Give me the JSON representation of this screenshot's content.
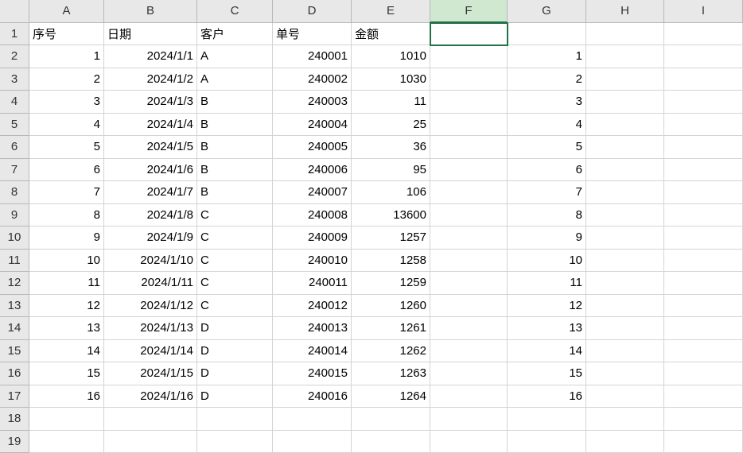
{
  "columns": [
    "A",
    "B",
    "C",
    "D",
    "E",
    "F",
    "G",
    "H",
    "I"
  ],
  "rowCount": 19,
  "selectedCell": "F1",
  "headers": {
    "A": "序号",
    "B": "日期",
    "C": "客户",
    "D": "单号",
    "E": "金额"
  },
  "chart_data": {
    "type": "table",
    "columns": [
      "序号",
      "日期",
      "客户",
      "单号",
      "金额",
      "",
      "G"
    ],
    "rows": [
      [
        1,
        "2024/1/1",
        "A",
        240001,
        1010,
        "",
        1
      ],
      [
        2,
        "2024/1/2",
        "A",
        240002,
        1030,
        "",
        2
      ],
      [
        3,
        "2024/1/3",
        "B",
        240003,
        11,
        "",
        3
      ],
      [
        4,
        "2024/1/4",
        "B",
        240004,
        25,
        "",
        4
      ],
      [
        5,
        "2024/1/5",
        "B",
        240005,
        36,
        "",
        5
      ],
      [
        6,
        "2024/1/6",
        "B",
        240006,
        95,
        "",
        6
      ],
      [
        7,
        "2024/1/7",
        "B",
        240007,
        106,
        "",
        7
      ],
      [
        8,
        "2024/1/8",
        "C",
        240008,
        13600,
        "",
        8
      ],
      [
        9,
        "2024/1/9",
        "C",
        240009,
        1257,
        "",
        9
      ],
      [
        10,
        "2024/1/10",
        "C",
        240010,
        1258,
        "",
        10
      ],
      [
        11,
        "2024/1/11",
        "C",
        240011,
        1259,
        "",
        11
      ],
      [
        12,
        "2024/1/12",
        "C",
        240012,
        1260,
        "",
        12
      ],
      [
        13,
        "2024/1/13",
        "D",
        240013,
        1261,
        "",
        13
      ],
      [
        14,
        "2024/1/14",
        "D",
        240014,
        1262,
        "",
        14
      ],
      [
        15,
        "2024/1/15",
        "D",
        240015,
        1263,
        "",
        15
      ],
      [
        16,
        "2024/1/16",
        "D",
        240016,
        1264,
        "",
        16
      ]
    ]
  }
}
